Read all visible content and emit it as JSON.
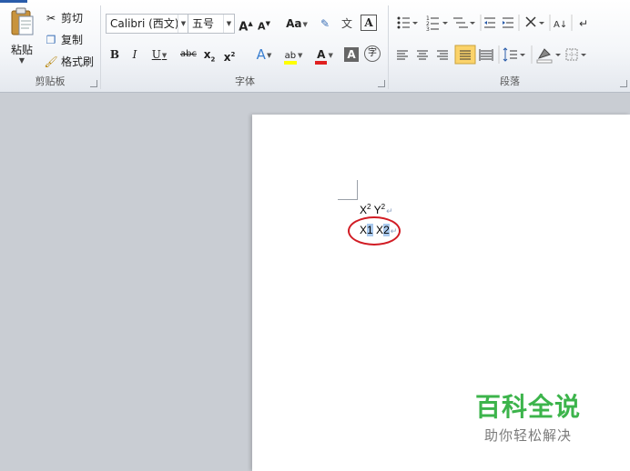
{
  "clipboard": {
    "paste_label": "粘贴",
    "cut_label": "剪切",
    "copy_label": "复制",
    "format_painter_label": "格式刷",
    "group_label": "剪贴板"
  },
  "font": {
    "font_name": "Calibri (西文)",
    "font_size": "五号",
    "grow_label": "A",
    "shrink_label": "A",
    "change_case_label": "Aa",
    "pinyin_label": "文",
    "border_label": "A",
    "bold_label": "B",
    "italic_label": "I",
    "underline_label": "U",
    "strike_label": "abc",
    "subscript_label": "x",
    "superscript_label": "x",
    "effects_label": "A",
    "highlight_label": "ab",
    "font_color_label": "A",
    "shading_label": "A",
    "enclose_label": "字",
    "group_label": "字体"
  },
  "paragraph": {
    "group_label": "段落",
    "sort_label": "A↓"
  },
  "document": {
    "line1_a": "X",
    "line1_a_sup": "2",
    "line1_b": "Y",
    "line1_b_sup": "2",
    "line2_a": "X",
    "line2_a_sel": "1",
    "line2_b": "X",
    "line2_b_sel": "2",
    "pilcrow": "↵"
  },
  "watermark": {
    "logo": "百科全说",
    "subtitle": "助你轻松解决"
  },
  "colors": {
    "highlight": "#ffff00",
    "font_color": "#e02020",
    "circle": "#d11c24",
    "watermark_green": "#3cb44b"
  }
}
